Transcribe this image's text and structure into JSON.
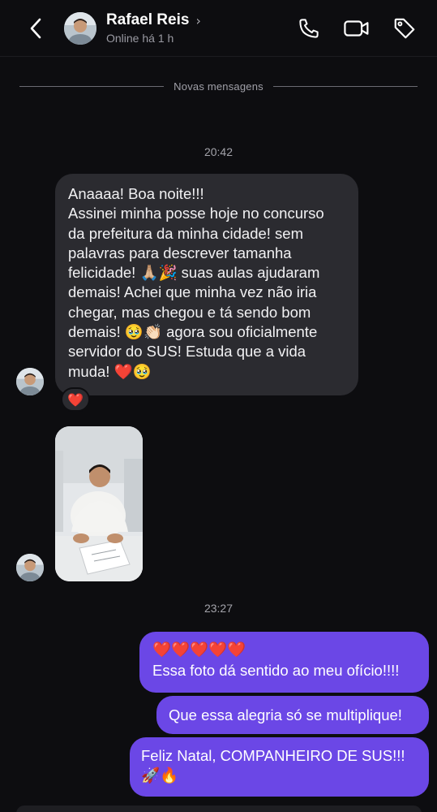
{
  "header": {
    "contact_name": "Rafael Reis",
    "status": "Online há 1 h",
    "icons": [
      "back-icon",
      "phone-icon",
      "video-camera-icon",
      "tag-icon"
    ]
  },
  "divider_label": "Novas mensagens",
  "messages": {
    "time1": "20:42",
    "incoming_text": "Anaaaa! Boa noite!!!\nAssinei minha posse hoje no concurso\nda prefeitura da minha cidade! sem\npalavras para descrever tamanha\nfelicidade! 🙏🏼🎉 suas aulas ajudaram\ndemais! Achei que minha vez não iria\nchegar, mas chegou e tá sendo bom\ndemais! 🥹👏🏻 agora sou oficialmente\nservidor do SUS! Estuda que a vida\nmuda! ❤️🥹",
    "reaction": "❤️",
    "time2": "23:27",
    "outgoing1_hearts": "❤️❤️❤️❤️❤️",
    "outgoing1_text": "Essa foto dá sentido ao meu ofício!!!!",
    "outgoing2_text": "Que essa alegria só se multiplique!",
    "outgoing3_text": "Feliz Natal, COMPANHEIRO DE SUS!!!",
    "outgoing3_emoji": "🚀🔥"
  },
  "colors": {
    "background": "#0d0d10",
    "incoming_bubble": "#2b2b30",
    "outgoing_bubble": "#6b47e6"
  }
}
